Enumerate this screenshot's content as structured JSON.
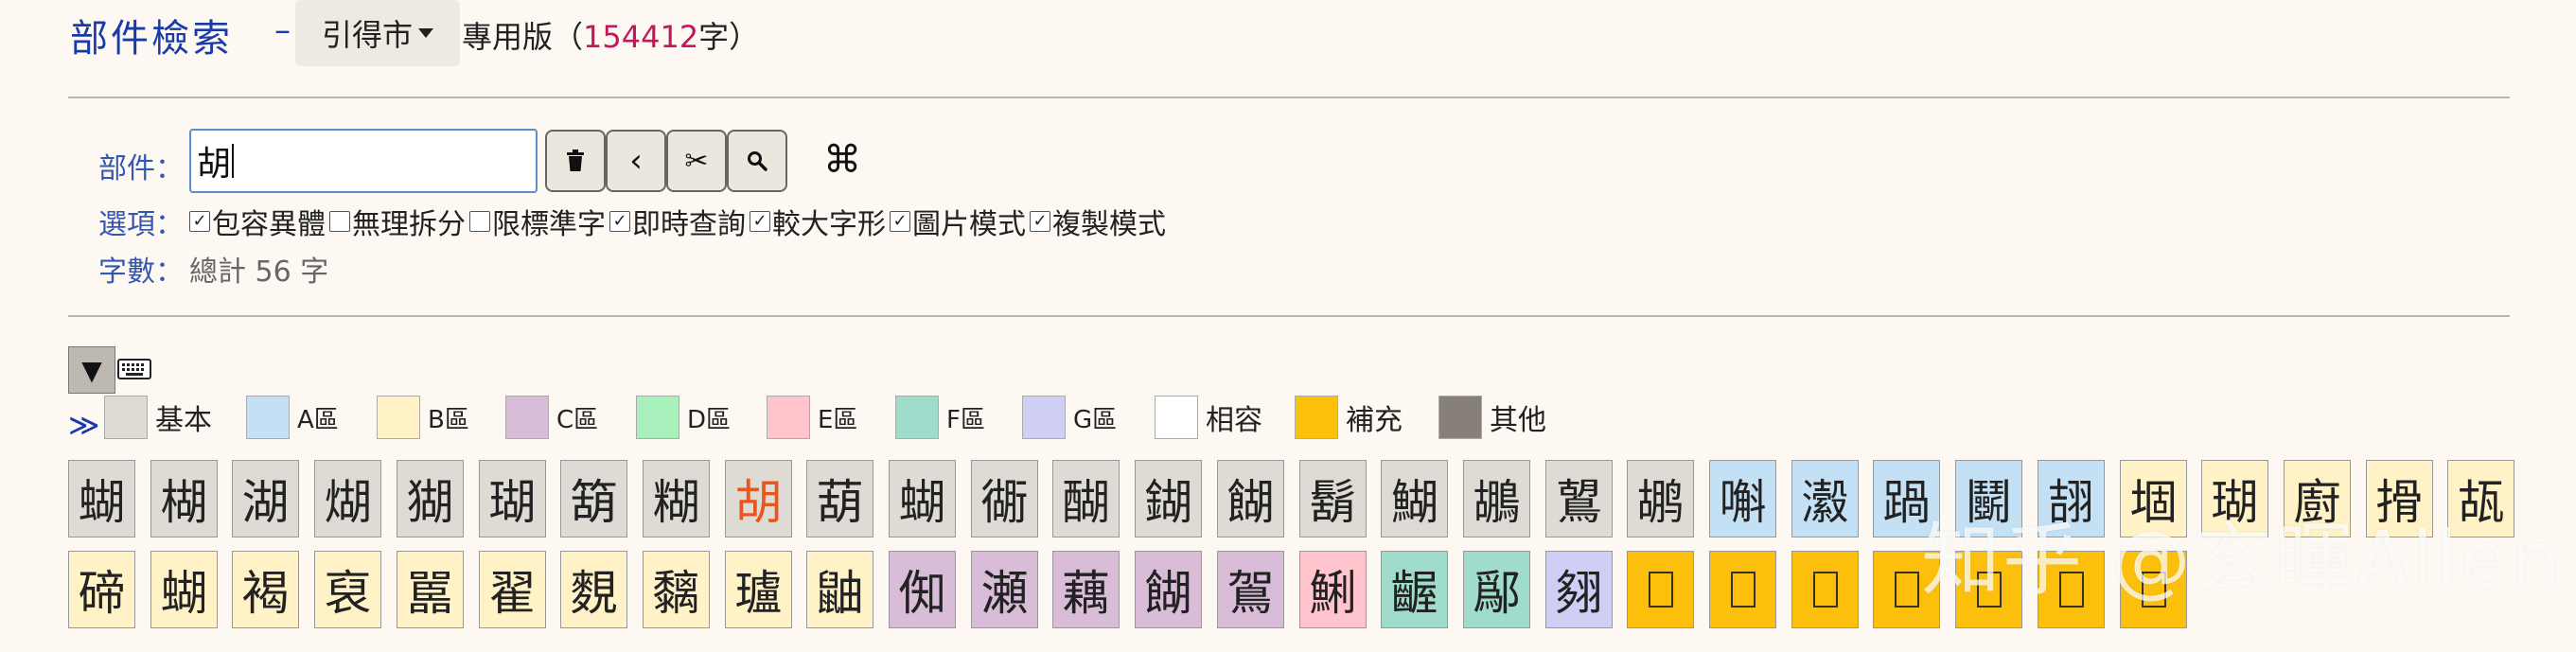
{
  "header": {
    "title": "部件檢索",
    "dash": "–",
    "dropdown_label": "引得市",
    "edition_prefix": "專用版（",
    "edition_count": "154412",
    "edition_suffix": "字）"
  },
  "form": {
    "component_label": "部件：",
    "component_value": "胡",
    "toolbar": {
      "delete_icon": "trash-icon",
      "back_label": "‹",
      "cut_label": "✂",
      "search_label": "🔍",
      "cmd_label": "⌘"
    },
    "options_label": "選項：",
    "options": [
      {
        "label": "包容異體",
        "checked": true
      },
      {
        "label": "無理拆分",
        "checked": false
      },
      {
        "label": "限標準字",
        "checked": false
      },
      {
        "label": "即時查詢",
        "checked": true
      },
      {
        "label": "較大字形",
        "checked": true
      },
      {
        "label": "圖片模式",
        "checked": true
      },
      {
        "label": "複製模式",
        "checked": true
      }
    ],
    "count_label": "字數：",
    "count_value": "總計 56 字"
  },
  "legend": {
    "collapse_label": "▼",
    "keyboard_icon": "keyboard-icon",
    "more_label": "≫",
    "items": [
      {
        "label": "基本",
        "color": "#dedad4"
      },
      {
        "label": "A區",
        "color": "#c4e0f5"
      },
      {
        "label": "B區",
        "color": "#fff2c6"
      },
      {
        "label": "C區",
        "color": "#d8bcd8"
      },
      {
        "label": "D區",
        "color": "#a8f0bc"
      },
      {
        "label": "E區",
        "color": "#ffc4cc"
      },
      {
        "label": "F區",
        "color": "#a0dccb"
      },
      {
        "label": "G區",
        "color": "#cfcff5"
      },
      {
        "label": "相容",
        "color": "#ffffff"
      },
      {
        "label": "補充",
        "color": "#fcbf0c"
      },
      {
        "label": "其他",
        "color": "#868079"
      }
    ]
  },
  "results": {
    "row1": [
      {
        "ch": "蝴",
        "cat": "basic"
      },
      {
        "ch": "楜",
        "cat": "basic"
      },
      {
        "ch": "湖",
        "cat": "basic"
      },
      {
        "ch": "煳",
        "cat": "basic"
      },
      {
        "ch": "猢",
        "cat": "basic"
      },
      {
        "ch": "瑚",
        "cat": "basic"
      },
      {
        "ch": "箶",
        "cat": "basic"
      },
      {
        "ch": "糊",
        "cat": "basic"
      },
      {
        "ch": "胡",
        "cat": "basic",
        "highlight": true
      },
      {
        "ch": "葫",
        "cat": "basic"
      },
      {
        "ch": "蝴",
        "cat": "basic"
      },
      {
        "ch": "衚",
        "cat": "basic"
      },
      {
        "ch": "醐",
        "cat": "basic"
      },
      {
        "ch": "鍸",
        "cat": "basic"
      },
      {
        "ch": "餬",
        "cat": "basic"
      },
      {
        "ch": "鬍",
        "cat": "basic"
      },
      {
        "ch": "鰗",
        "cat": "basic"
      },
      {
        "ch": "鶘",
        "cat": "basic"
      },
      {
        "ch": "鶦",
        "cat": "basic"
      },
      {
        "ch": "鹕",
        "cat": "basic"
      },
      {
        "ch": "嘝",
        "cat": "a"
      },
      {
        "ch": "瀫",
        "cat": "a"
      },
      {
        "ch": "踻",
        "cat": "a"
      },
      {
        "ch": "鬭",
        "cat": "a"
      },
      {
        "ch": "翓",
        "cat": "a"
      },
      {
        "ch": "堌",
        "cat": "b"
      },
      {
        "ch": "瑚",
        "cat": "b"
      },
      {
        "ch": "廚",
        "cat": "b"
      },
      {
        "ch": "搰",
        "cat": "b"
      },
      {
        "ch": "瓳",
        "cat": "b"
      }
    ],
    "row2": [
      {
        "ch": "碲",
        "cat": "b"
      },
      {
        "ch": "蝴",
        "cat": "b"
      },
      {
        "ch": "褐",
        "cat": "b"
      },
      {
        "ch": "裒",
        "cat": "b"
      },
      {
        "ch": "嚚",
        "cat": "b"
      },
      {
        "ch": "翟",
        "cat": "b"
      },
      {
        "ch": "麲",
        "cat": "b"
      },
      {
        "ch": "黐",
        "cat": "b"
      },
      {
        "ch": "瓐",
        "cat": "b"
      },
      {
        "ch": "鼬",
        "cat": "b"
      },
      {
        "ch": "倁",
        "cat": "c"
      },
      {
        "ch": "瀬",
        "cat": "c"
      },
      {
        "ch": "藕",
        "cat": "c"
      },
      {
        "ch": "餬",
        "cat": "c"
      },
      {
        "ch": "鴐",
        "cat": "c"
      },
      {
        "ch": "鯏",
        "cat": "e"
      },
      {
        "ch": "齷",
        "cat": "f"
      },
      {
        "ch": "鄬",
        "cat": "f"
      },
      {
        "ch": "翗",
        "cat": "g"
      },
      {
        "ch": "",
        "cat": "supp"
      },
      {
        "ch": "",
        "cat": "supp"
      },
      {
        "ch": "",
        "cat": "supp"
      },
      {
        "ch": "",
        "cat": "supp"
      },
      {
        "ch": "",
        "cat": "supp"
      },
      {
        "ch": "",
        "cat": "supp"
      },
      {
        "ch": "",
        "cat": "supp"
      }
    ]
  },
  "watermark": "知乎 @玄暉Allen"
}
